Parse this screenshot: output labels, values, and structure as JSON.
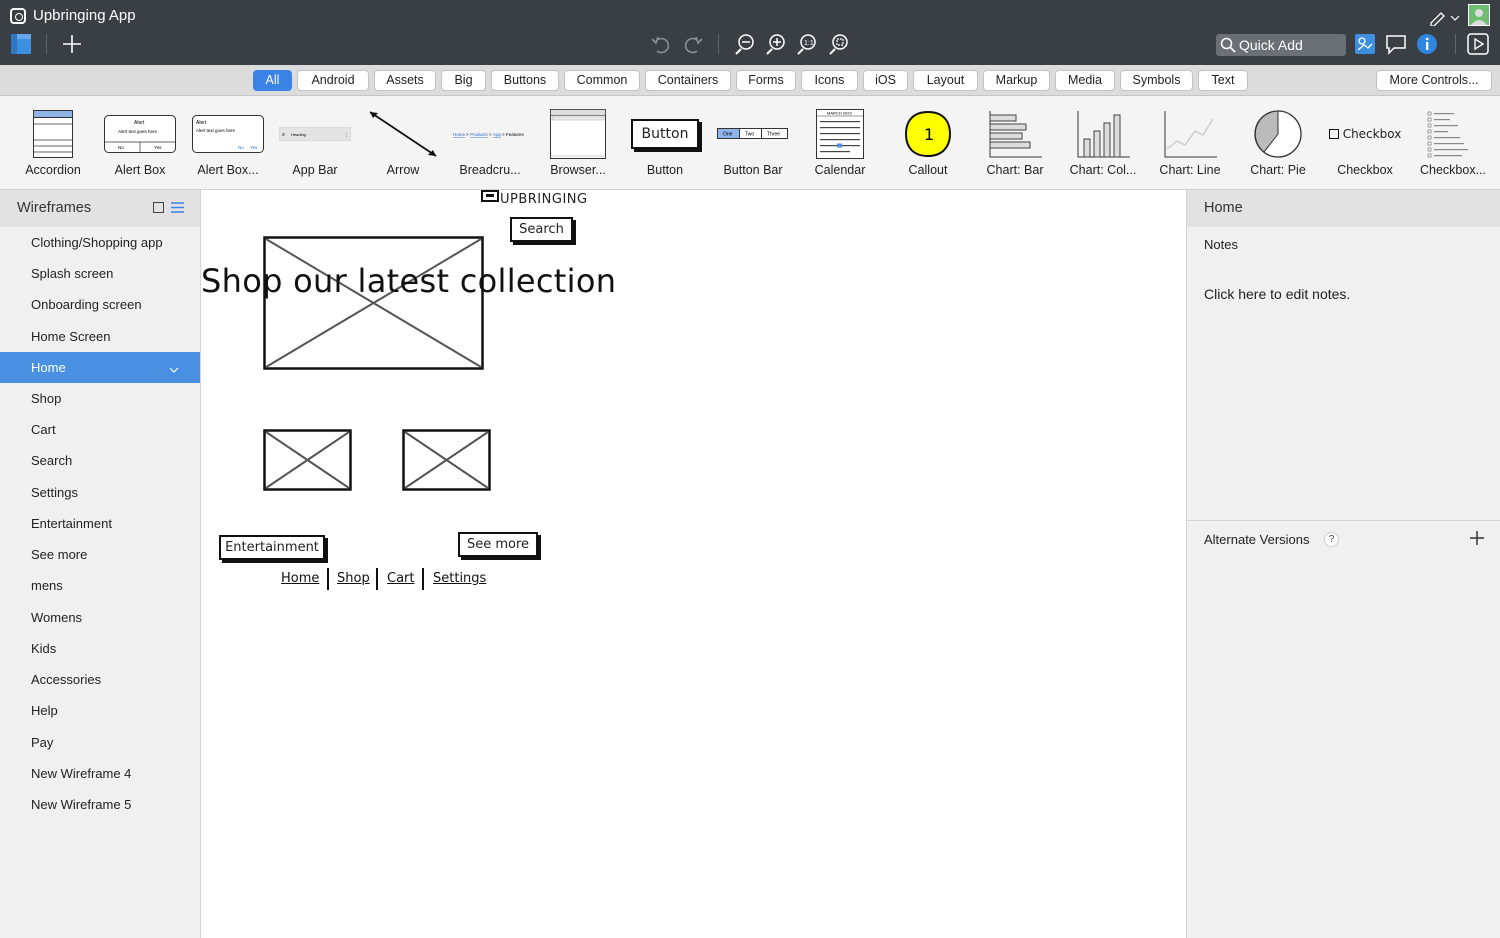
{
  "app": {
    "title": "Upbringing App"
  },
  "toolbar": {
    "quick_add": "Quick Add"
  },
  "categories": [
    "All",
    "Android",
    "Assets",
    "Big",
    "Buttons",
    "Common",
    "Containers",
    "Forms",
    "Icons",
    "iOS",
    "Layout",
    "Markup",
    "Media",
    "Symbols",
    "Text"
  ],
  "more_controls": "More Controls...",
  "library": [
    "Accordion",
    "Alert Box",
    "Alert Box...",
    "App Bar",
    "Arrow",
    "Breadcru...",
    "Browser...",
    "Button",
    "Button Bar",
    "Calendar",
    "Callout",
    "Chart: Bar",
    "Chart: Col...",
    "Chart: Line",
    "Chart: Pie",
    "Checkbox",
    "Checkbox..."
  ],
  "library_thumbs": {
    "button": "Button",
    "button_bar": [
      "One",
      "Two",
      "Three"
    ],
    "callout": "1",
    "checkbox": "Checkbox",
    "calendar_title": "MARCH 2023",
    "alert_title": "Alert",
    "alert_text": "Alert text goes here",
    "alert_no": "No",
    "alert_yes": "Yes",
    "app_bar_text": "Heading",
    "breadcrumb": [
      "Home",
      "Products",
      "App",
      "Features"
    ]
  },
  "sidebar": {
    "title": "Wireframes",
    "items": [
      "Clothing/Shopping app",
      "Splash screen",
      "Onboarding screen",
      "Home Screen",
      "Home",
      "Shop",
      "Cart",
      "Search",
      "Settings",
      "Entertainment",
      "See more",
      "mens",
      "Womens",
      "Kids",
      "Accessories",
      "Help",
      "Pay",
      "New Wireframe 4",
      "New Wireframe 5"
    ],
    "active_index": 4
  },
  "canvas": {
    "logo_text": "UPBRINGING",
    "search_button": "Search",
    "headline": "Shop our latest collection",
    "entertainment_button": "Entertainment",
    "see_more_button": "See more",
    "nav_links": [
      "Home",
      "Shop",
      "Cart",
      "Settings"
    ]
  },
  "rightpanel": {
    "title": "Home",
    "notes_label": "Notes",
    "notes_text": "Click here to edit notes.",
    "alternate_versions": "Alternate Versions",
    "help": "?"
  },
  "colors": {
    "accent": "#4a90e2",
    "titlebar": "#3a3f45",
    "callout": "#ffff00"
  }
}
